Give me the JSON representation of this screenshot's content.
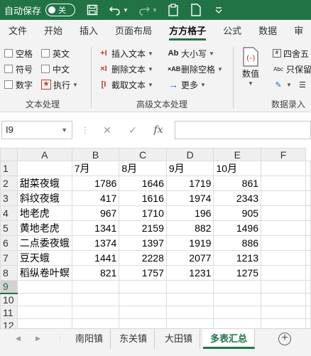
{
  "titlebar": {
    "autosave_label": "自动保存",
    "autosave_state": "关"
  },
  "tabs": [
    "文件",
    "开始",
    "插入",
    "页面布局",
    "方方格子",
    "公式",
    "数据",
    "审"
  ],
  "active_tab": "方方格子",
  "ribbon": {
    "group1": {
      "checkboxes": [
        "空格",
        "英文",
        "符号",
        "中文",
        "数字"
      ],
      "exec_label": "执行",
      "label": "文本处理"
    },
    "group2": {
      "insert_text": "插入文本",
      "delete_text": "删除文本",
      "cut_text": "截取文本",
      "case_label": "大小写",
      "delete_space": "删除空格",
      "more": "更多",
      "label": "高级文本处理"
    },
    "group3": {
      "value_label": "数值",
      "round_label": "四舍五",
      "keep_label": "只保留",
      "label": "数据录入"
    }
  },
  "formula_bar": {
    "name_box": "I9",
    "fx": "fx"
  },
  "sheet": {
    "columns": [
      "A",
      "B",
      "C",
      "D",
      "E",
      "F"
    ],
    "rows": [
      {
        "n": "1",
        "cells": [
          "",
          "7月",
          "8月",
          "9月",
          "10月",
          ""
        ]
      },
      {
        "n": "2",
        "cells": [
          "甜菜夜蛾",
          "1786",
          "1646",
          "1719",
          "861",
          ""
        ]
      },
      {
        "n": "3",
        "cells": [
          "斜纹夜蛾",
          "417",
          "1616",
          "1974",
          "2343",
          ""
        ]
      },
      {
        "n": "4",
        "cells": [
          "地老虎",
          "967",
          "1710",
          "196",
          "905",
          ""
        ]
      },
      {
        "n": "5",
        "cells": [
          "黄地老虎",
          "1341",
          "2159",
          "882",
          "1496",
          ""
        ]
      },
      {
        "n": "6",
        "cells": [
          "二点委夜蛾",
          "1374",
          "1397",
          "1919",
          "886",
          ""
        ]
      },
      {
        "n": "7",
        "cells": [
          "豆天蛾",
          "1441",
          "2228",
          "2077",
          "1213",
          ""
        ]
      },
      {
        "n": "8",
        "cells": [
          "稻纵卷叶螟",
          "821",
          "1757",
          "1231",
          "1275",
          ""
        ]
      },
      {
        "n": "9",
        "cells": [
          "",
          "",
          "",
          "",
          "",
          ""
        ]
      },
      {
        "n": "10",
        "cells": [
          "",
          "",
          "",
          "",
          "",
          ""
        ]
      },
      {
        "n": "11",
        "cells": [
          "",
          "",
          "",
          "",
          "",
          ""
        ]
      },
      {
        "n": "12",
        "cells": [
          "",
          "",
          "",
          "",
          "",
          ""
        ]
      },
      {
        "n": "13",
        "cells": [
          "",
          "",
          "",
          "",
          "",
          ""
        ]
      }
    ]
  },
  "sheet_tabs": [
    "南阳镇",
    "东关镇",
    "大田镇",
    "多表汇总"
  ],
  "active_sheet": "多表汇总",
  "colors": {
    "accent": "#217346",
    "ribbon_bg": "#f3f3f3"
  }
}
